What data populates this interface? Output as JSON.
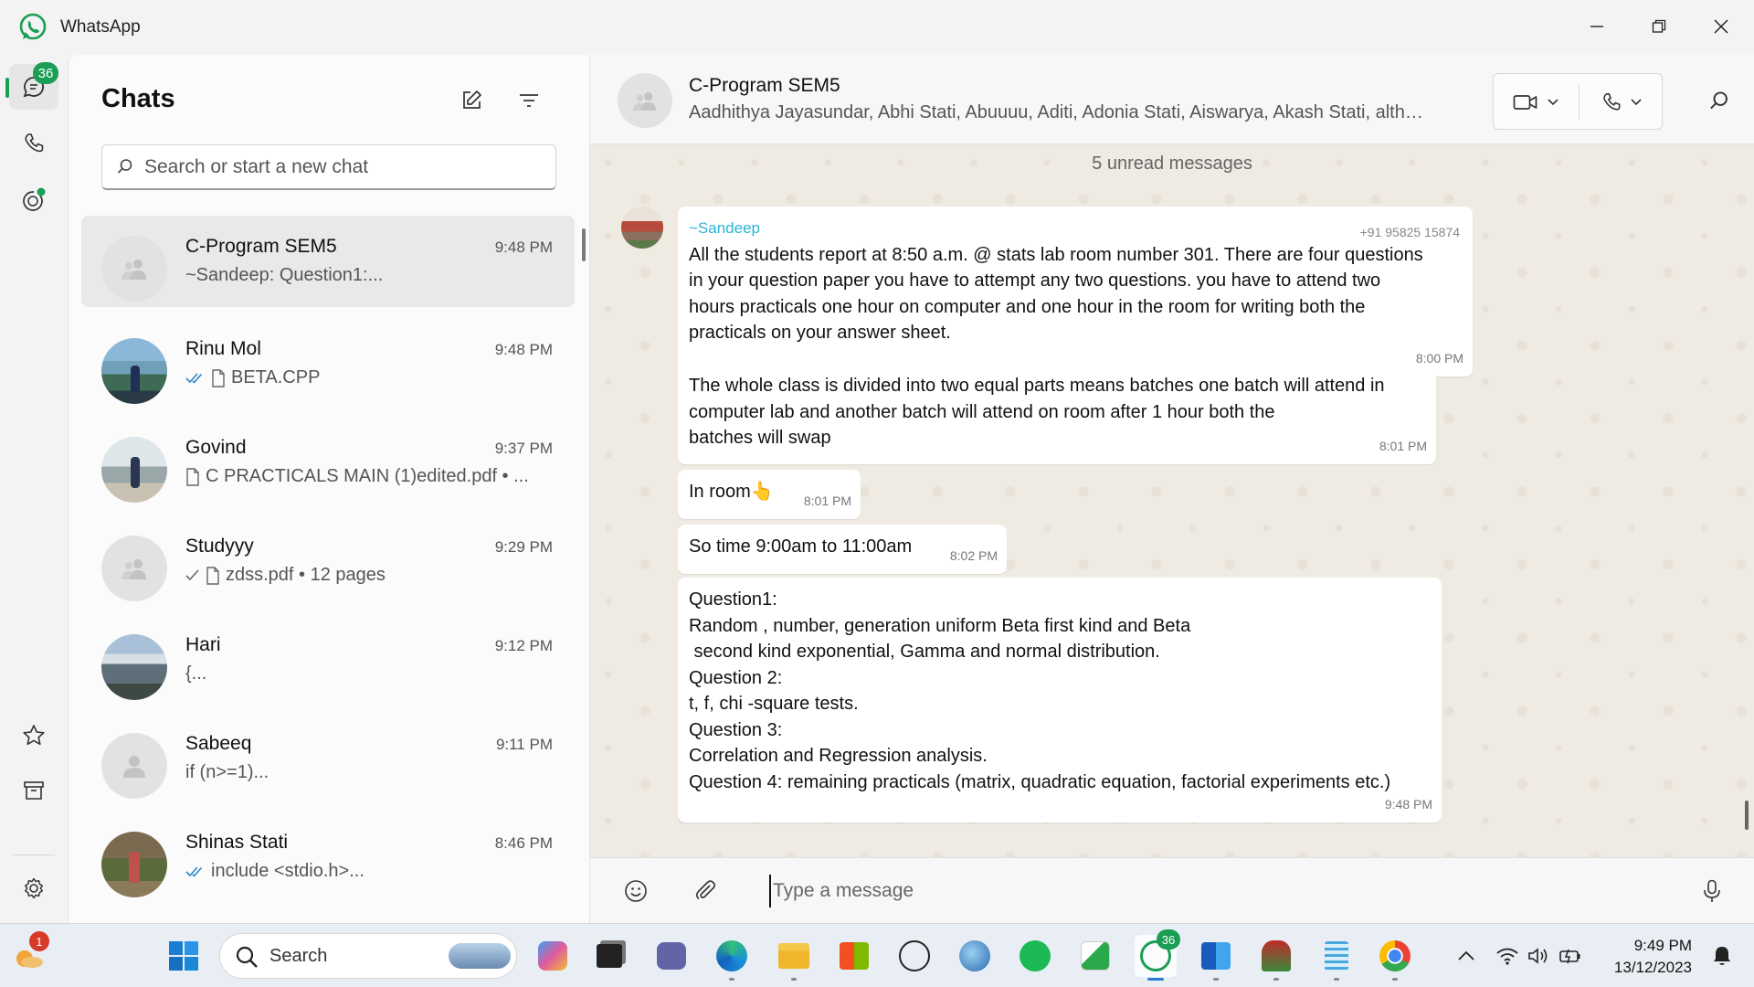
{
  "window": {
    "title": "WhatsApp"
  },
  "rail": {
    "chats_badge": "36"
  },
  "list": {
    "title": "Chats",
    "search_placeholder": "Search or start a new chat",
    "chats": [
      {
        "name": "C-Program SEM5",
        "time": "9:48 PM",
        "preview": "~Sandeep: Question1:..."
      },
      {
        "name": "Rinu Mol",
        "time": "9:48 PM",
        "preview": "BETA.CPP"
      },
      {
        "name": "Govind",
        "time": "9:37 PM",
        "preview": "C PRACTICALS MAIN (1)edited.pdf • ..."
      },
      {
        "name": "Studyyy",
        "time": "9:29 PM",
        "preview": "zdss.pdf • 12 pages"
      },
      {
        "name": "Hari",
        "time": "9:12 PM",
        "preview": "{..."
      },
      {
        "name": "Sabeeq",
        "time": "9:11 PM",
        "preview": "if (n>=1)..."
      },
      {
        "name": "Shinas Stati",
        "time": "8:46 PM",
        "preview": "include <stdio.h>..."
      }
    ]
  },
  "conversation": {
    "name": "C-Program SEM5",
    "members": "Aadhithya Jayasundar, Abhi Stati, Abuuuu, Aditi, Adonia Stati, Aiswarya, Akash Stati, althaf, Amal, Amrutha, Anagha",
    "unread_label": "5 unread messages",
    "messages": [
      {
        "sender": "~Sandeep",
        "phone": "+91 95825 15874",
        "lines": [
          "All the students report at 8:50 a.m. @ stats lab room number 301. There are four questions",
          "in your question paper you have to attempt any two questions. you have to attend two",
          "hours practicals one hour on computer and one hour in the room for writing both the",
          "practicals on your answer sheet."
        ],
        "time": "8:00 PM"
      },
      {
        "lines": [
          "The whole class is divided into two equal parts means batches one batch will attend in",
          "computer lab and another batch will attend on room after 1 hour both the",
          "batches will swap"
        ],
        "time": "8:01 PM"
      },
      {
        "lines": [
          "In room👆"
        ],
        "time": "8:01 PM"
      },
      {
        "lines": [
          "So time 9:00am to 11:00am"
        ],
        "time": "8:02 PM"
      },
      {
        "lines": [
          "Question1:",
          "Random , number, generation uniform Beta first kind and Beta",
          " second kind exponential, Gamma and normal distribution.",
          "Question 2:",
          "t, f, chi -square tests.",
          "Question 3:",
          "Correlation and Regression analysis.",
          "Question 4: remaining practicals (matrix, quadratic equation, factorial experiments etc.)"
        ],
        "time": "9:48 PM"
      }
    ],
    "composer_placeholder": "Type a message"
  },
  "taskbar": {
    "search_label": "Search",
    "weather_badge": "1",
    "whatsapp_badge": "36",
    "time": "9:49 PM",
    "date": "13/12/2023"
  },
  "colors": {
    "accent": "#1a9e55",
    "sender": "#2bb3d5"
  }
}
